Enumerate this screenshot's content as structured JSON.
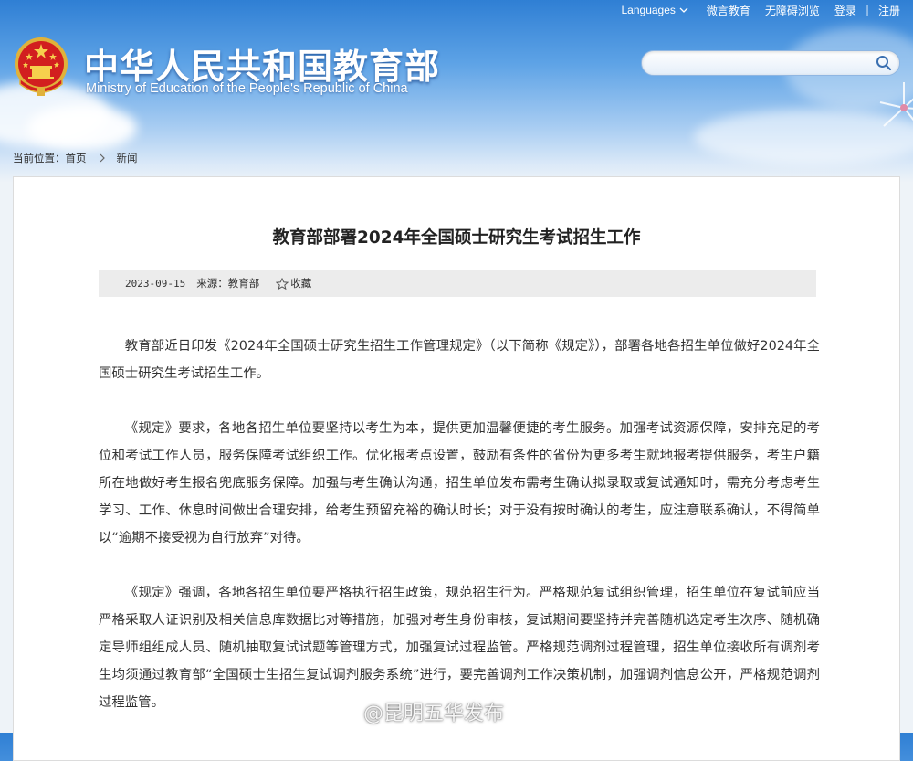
{
  "topbar": {
    "languages": "Languages",
    "weibo": "微言教育",
    "accessible": "无障碍浏览",
    "login": "登录",
    "separator": "|",
    "register": "注册"
  },
  "header": {
    "title": "中华人民共和国教育部",
    "subtitle": "Ministry of Education of the People's Republic of China",
    "search_placeholder": ""
  },
  "breadcrumb": {
    "label": "当前位置：",
    "home": "首页",
    "current": "新闻"
  },
  "article": {
    "title": "教育部部署2024年全国硕士研究生考试招生工作",
    "date": "2023-09-15",
    "source": "来源：教育部",
    "favorite": "收藏",
    "paragraphs": [
      "教育部近日印发《2024年全国硕士研究生招生工作管理规定》（以下简称《规定》），部署各地各招生单位做好2024年全国硕士研究生考试招生工作。",
      "《规定》要求，各地各招生单位要坚持以考生为本，提供更加温馨便捷的考生服务。加强考试资源保障，安排充足的考位和考试工作人员，服务保障考试组织工作。优化报考点设置，鼓励有条件的省份为更多考生就地报考提供服务，考生户籍所在地做好考生报名兜底服务保障。加强与考生确认沟通，招生单位发布需考生确认拟录取或复试通知时，需充分考虑考生学习、工作、休息时间做出合理安排，给考生预留充裕的确认时长；对于没有按时确认的考生，应注意联系确认，不得简单以“逾期不接受视为自行放弃”对待。",
      "《规定》强调，各地各招生单位要严格执行招生政策，规范招生行为。严格规范复试组织管理，招生单位在复试前应当严格采取人证识别及相关信息库数据比对等措施，加强对考生身份审核，复试期间要坚持并完善随机选定考生次序、随机确定导师组组成人员、随机抽取复试试题等管理方式，加强复试过程监管。严格规范调剂过程管理，招生单位接收所有调剂考生均须通过教育部“全国硕士生招生复试调剂服务系统”进行，要完善调剂工作决策机制，加强调剂信息公开，严格规范调剂过程监管。"
    ]
  },
  "watermark": "@昆明五华发布",
  "colors": {
    "sky_top": "#2f7fd4",
    "emblem_red": "#d21f1f",
    "emblem_gold": "#f2c230",
    "text": "#333333",
    "meta_bg": "#ececec"
  },
  "icons": {
    "search": "search-icon",
    "languages": "chevron-down-icon",
    "breadcrumb": "chevron-right-icon",
    "favorite": "star-icon",
    "emblem": "national-emblem-icon"
  }
}
